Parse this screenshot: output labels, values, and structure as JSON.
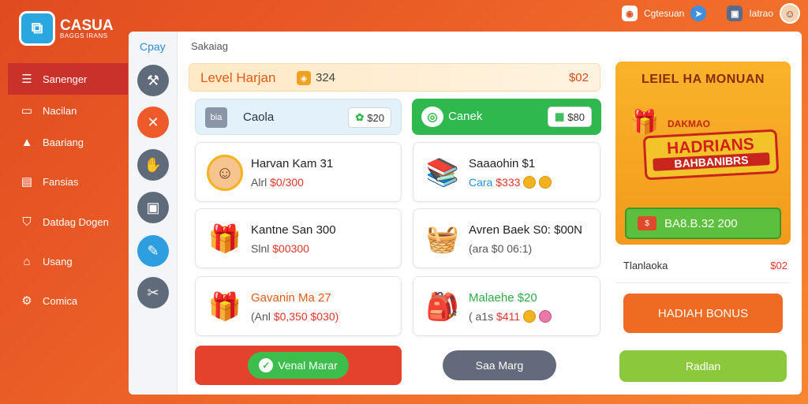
{
  "app": {
    "logo_icon": "⧉",
    "logo_title": "CASUA",
    "logo_sub": "BAGGS IRANS"
  },
  "topbar": {
    "item1": "Cgtesuan",
    "item2": "Iatrao"
  },
  "sidebar": {
    "items": [
      {
        "label": "Sanenger",
        "icon": "list-icon"
      },
      {
        "label": "Nacilan",
        "icon": "window-icon"
      },
      {
        "label": "Baariang",
        "icon": "warning-icon"
      },
      {
        "label": "Fansias",
        "icon": "document-icon"
      },
      {
        "label": "Datdag Dogen",
        "icon": "shield-icon"
      },
      {
        "label": "Usang",
        "icon": "home-icon"
      },
      {
        "label": "Comica",
        "icon": "gear-icon"
      }
    ]
  },
  "rail": {
    "title": "Cpay"
  },
  "panel": {
    "title": "Sakaiag"
  },
  "level": {
    "title": "Level Harjan",
    "value": "324",
    "right": "$02"
  },
  "left_col": {
    "header": {
      "icon_text": "bia",
      "label": "Caola",
      "pill": "$20"
    },
    "cards": [
      {
        "name": "Harvan Kam 31",
        "sub_prefix": "Alrl",
        "sub_value": "$0/300"
      },
      {
        "name": "Kantne San 300",
        "sub_prefix": "Slnl",
        "sub_value": "$00300"
      },
      {
        "name": "Gavanin Ma 27",
        "sub_prefix": "(Anl",
        "sub_value": "$0,350 $030)"
      }
    ],
    "button": "Venal Marar"
  },
  "right_col": {
    "header": {
      "label": "Canek",
      "pill": "$80"
    },
    "cards": [
      {
        "name": "Saaaohin $1",
        "sub_prefix": "Cara",
        "sub_value": "$333"
      },
      {
        "name": "Avren Baek S0: $00N",
        "sub_prefix": "(ara",
        "sub_value": "$0 06:1)"
      },
      {
        "name": "Malaehe $20",
        "sub_prefix": "( a1s",
        "sub_value": "$411"
      }
    ],
    "button": "Saa Marg"
  },
  "promo": {
    "title": "LEIEL HA MONUAN",
    "small": "DAKMAO",
    "banner_main": "HADRIANS",
    "banner_sub": "BAHBANIBRS",
    "amount": "BA8.B.32 200",
    "line_label": "Tlanlaoka",
    "line_value": "$02",
    "bonus_button": "HADIAH BONUS",
    "green_button": "Radlan"
  },
  "colors": {
    "brand": "#e04b20",
    "accent_green": "#2fb84e",
    "accent_blue": "#2a8fd8"
  }
}
